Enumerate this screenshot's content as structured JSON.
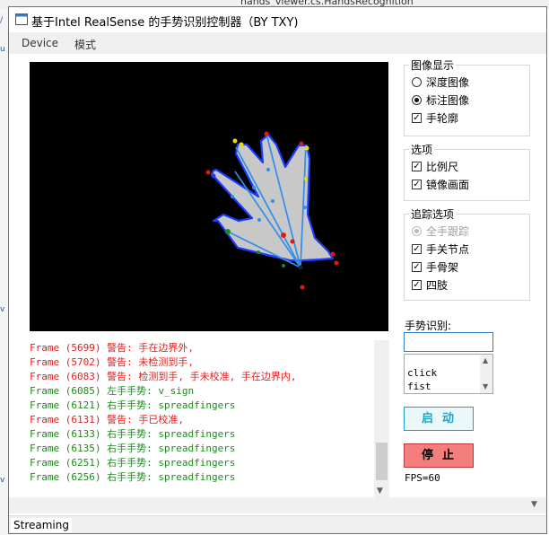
{
  "background_window": {
    "title": "hands_viewer.cs.HandsRecognition"
  },
  "window": {
    "title": "基于Intel RealSense 的手势识别控制器（BY TXY)"
  },
  "menu": [
    "Device",
    "模式"
  ],
  "image_display": {
    "title": "图像显示",
    "options": [
      {
        "label": "深度图像",
        "type": "radio",
        "checked": false
      },
      {
        "label": "标注图像",
        "type": "radio",
        "checked": true
      },
      {
        "label": "手轮廓",
        "type": "checkbox",
        "checked": true
      }
    ]
  },
  "options_group": {
    "title": "选项",
    "options": [
      {
        "label": "比例尺",
        "checked": true
      },
      {
        "label": "镜像画面",
        "checked": true
      }
    ]
  },
  "tracking_group": {
    "title": "追踪选项",
    "options": [
      {
        "label": "全手跟踪",
        "type": "radio",
        "checked": true,
        "disabled": true
      },
      {
        "label": "手关节点",
        "type": "checkbox",
        "checked": true
      },
      {
        "label": "手骨架",
        "type": "checkbox",
        "checked": true
      },
      {
        "label": "四肢",
        "type": "checkbox",
        "checked": true
      }
    ]
  },
  "gesture": {
    "label": "手势识别:",
    "input_value": "",
    "list": [
      "click",
      "fist"
    ]
  },
  "buttons": {
    "start": "启动",
    "stop": "停止"
  },
  "fps": "FPS=60",
  "log": [
    {
      "text": "Frame (5699) 警告: 手在边界外,",
      "color": "#e02020"
    },
    {
      "text": "Frame (5702) 警告: 未检测到手,",
      "color": "#e02020"
    },
    {
      "text": "Frame (6083) 警告: 检测到手, 手未校准, 手在边界内,",
      "color": "#e02020"
    },
    {
      "text": "Frame (6085) 左手手势: v_sign",
      "color": "#1e8a1e"
    },
    {
      "text": "Frame (6121) 右手手势: spreadfingers",
      "color": "#1e8a1e"
    },
    {
      "text": "Frame (6131) 警告: 手已校准,",
      "color": "#e02020"
    },
    {
      "text": "Frame (6133) 右手手势: spreadfingers",
      "color": "#1e8a1e"
    },
    {
      "text": "Frame (6135) 右手手势: spreadfingers",
      "color": "#1e8a1e"
    },
    {
      "text": "Frame (6251) 右手手势: spreadfingers",
      "color": "#1e8a1e"
    },
    {
      "text": "Frame (6256) 右手手势: spreadfingers",
      "color": "#1e8a1e"
    }
  ],
  "status": "Streaming",
  "colors": {
    "skeleton": "#2f8fe8",
    "contour": "#1a3cff",
    "hand_fill": "#c8c8c8",
    "joint": "#e01818"
  }
}
